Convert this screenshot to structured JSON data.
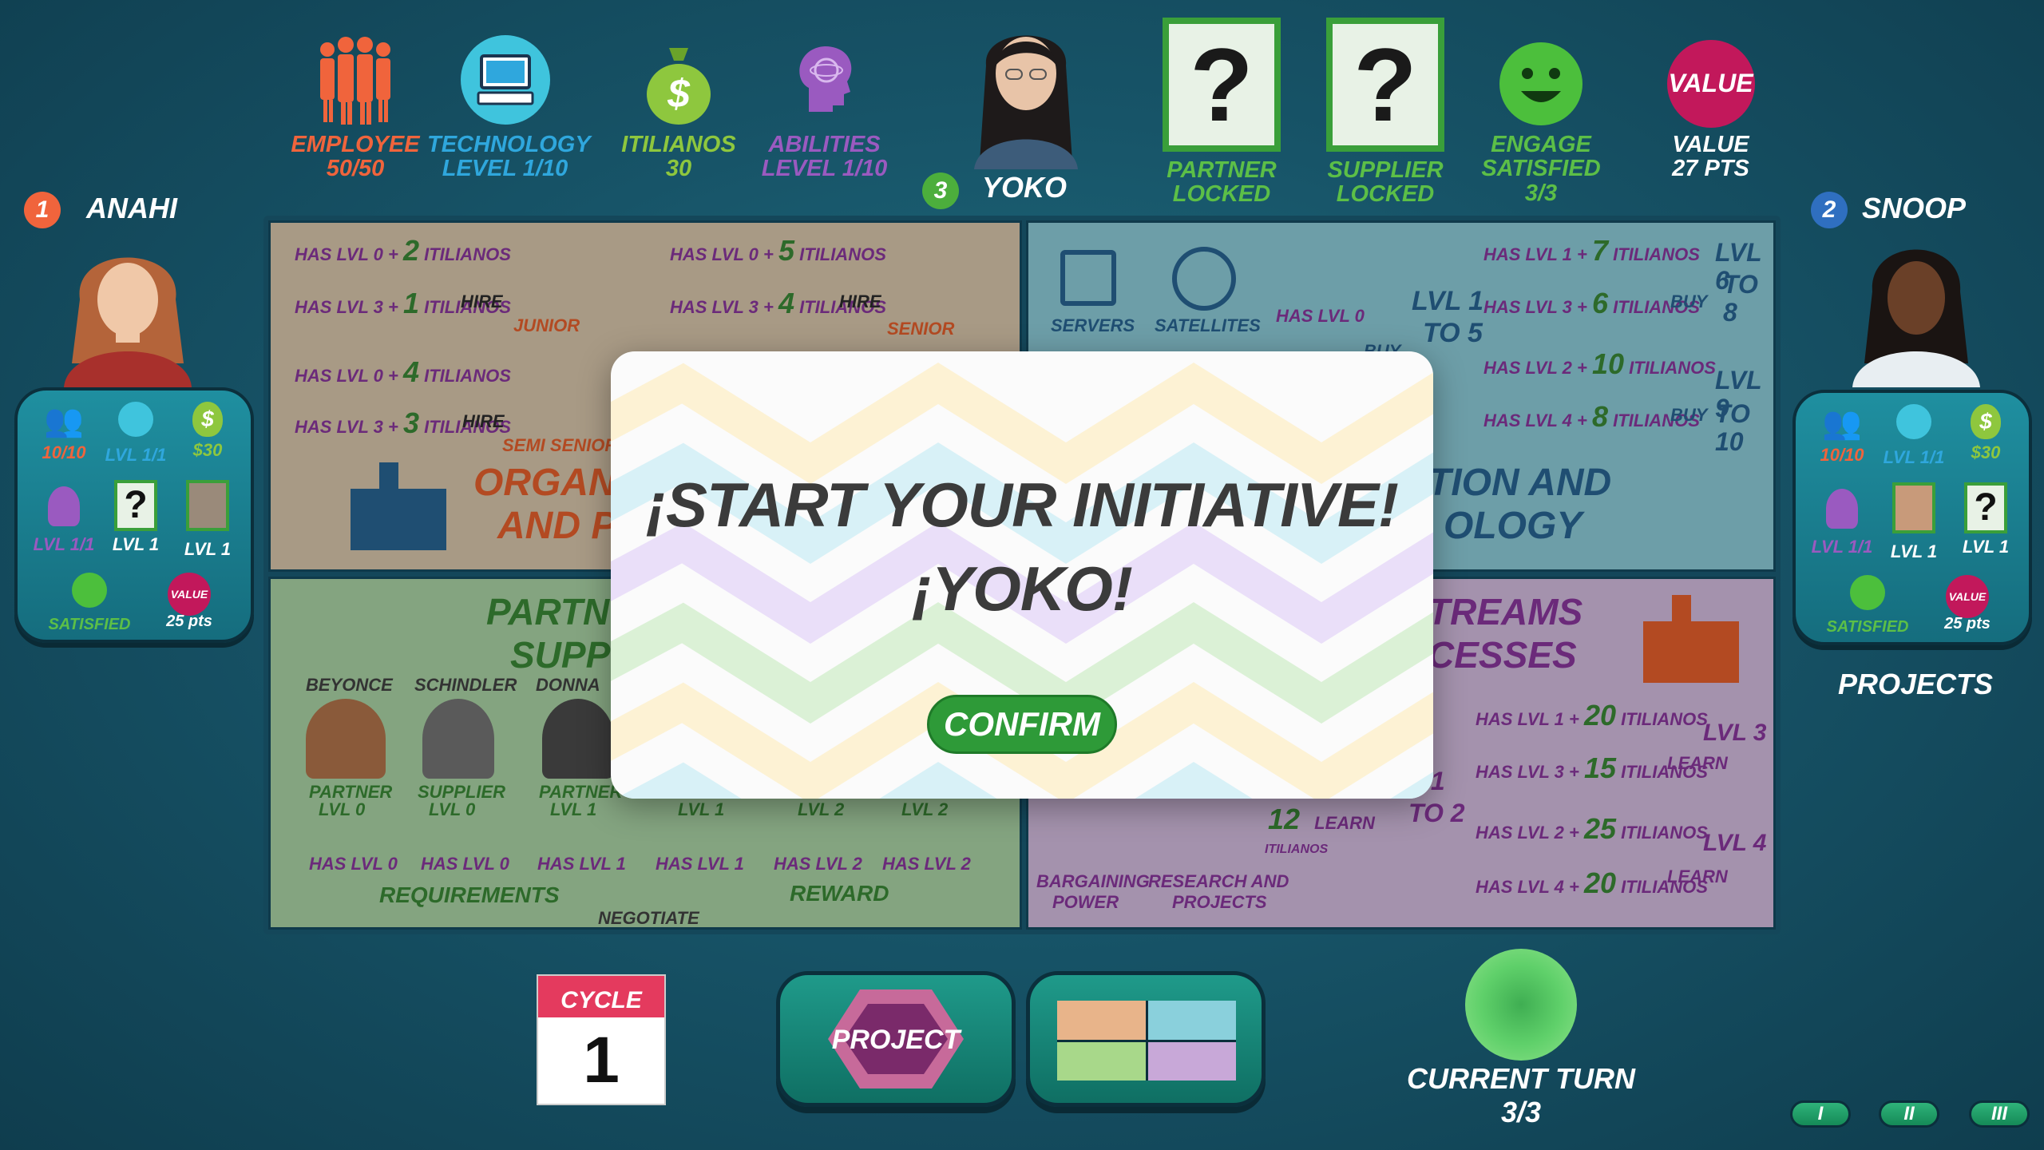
{
  "top_stats": {
    "employee": {
      "label": "EMPLOYEE",
      "value": "50/50",
      "icon": "employees-icon"
    },
    "technology": {
      "label": "TECHNOLOGY",
      "value": "LEVEL  1/10",
      "icon": "computer-icon"
    },
    "itilianos": {
      "label": "ITILIANOS",
      "value": "30",
      "icon": "money-bag-icon"
    },
    "abilities": {
      "label": "ABILITIES",
      "value": "LEVEL  1/10",
      "icon": "brain-head-icon"
    },
    "current_player": {
      "number": "3",
      "name": "YOKO"
    },
    "partner": {
      "label": "PARTNER",
      "status": "LOCKED"
    },
    "supplier": {
      "label": "SUPPLIER",
      "status": "LOCKED"
    },
    "engage": {
      "label1": "ENGAGE",
      "label2": "SATISFIED",
      "value": "3/3"
    },
    "value": {
      "badge": "VALUE",
      "label": "VALUE",
      "pts": "27 PTS"
    }
  },
  "players": {
    "left": {
      "number": "1",
      "name": "ANAHI",
      "employees": "10/10",
      "tech": "LVL 1/1",
      "money": "$30",
      "abilities": "LVL 1/1",
      "partner": "LVL 1",
      "supplier": "LVL 1",
      "engage": "SATISFIED",
      "value_badge": "VALUE",
      "value": "25 pts"
    },
    "right": {
      "number": "2",
      "name": "SNOOP",
      "employees": "10/10",
      "tech": "LVL 1/1",
      "money": "$30",
      "abilities": "LVL 1/1",
      "partner": "LVL 1",
      "supplier": "LVL 1",
      "engage": "SATISFIED",
      "value_badge": "VALUE",
      "value": "25 pts",
      "projects_label": "PROJECTS"
    }
  },
  "board": {
    "org": {
      "row1": {
        "req": "HAS LVL 0",
        "cost": "2",
        "cur": "ITILIANOS",
        "action": "HIRE",
        "role": "JUNIOR"
      },
      "row2": {
        "req": "HAS LVL 3",
        "cost": "1",
        "cur": "ITILIANOS"
      },
      "row3": {
        "req": "HAS LVL 0",
        "cost": "5",
        "cur": "ITILIANOS",
        "action": "HIRE",
        "role": "SENIOR"
      },
      "row4": {
        "req": "HAS LVL 3",
        "cost": "4",
        "cur": "ITILIANOS"
      },
      "row5": {
        "req": "HAS LVL 0",
        "cost": "4",
        "cur": "ITILIANOS",
        "action": "HIRE",
        "role": "SEMI SENIOR"
      },
      "row6": {
        "req": "HAS LVL 3",
        "cost": "3",
        "cur": "ITILIANOS"
      },
      "title1": "ORGANI",
      "title2": "AND P"
    },
    "tech": {
      "servers": "SERVERS",
      "satellites": "SATELLITES",
      "lvl0": "HAS LVL 0",
      "buy": "BUY",
      "lvl_range1": "LVL 1",
      "lvl_range1b": "TO 5",
      "r1": {
        "req": "HAS LVL 1",
        "cost": "7",
        "cur": "ITILIANOS"
      },
      "r2": {
        "req": "HAS LVL 3",
        "cost": "6",
        "cur": "ITILIANOS"
      },
      "r3": {
        "req": "HAS LVL 2",
        "cost": "10",
        "cur": "ITILIANOS"
      },
      "r4": {
        "req": "HAS LVL 4",
        "cost": "8",
        "cur": "ITILIANOS"
      },
      "buy1": "BUY",
      "buy2": "BUY",
      "lvl6": "LVL 6",
      "to8": "TO 8",
      "lvl9": "LVL 9",
      "to10": "TO 10",
      "title1": "TION AND",
      "title2": "OLOGY"
    },
    "partners": {
      "title1": "PARTN",
      "title2": "SUPP",
      "beyonce": "BEYONCE",
      "schindler": "SCHINDLER",
      "donna": "DONNA",
      "p1_role": "PARTNER",
      "p1_lvl": "LVL 0",
      "p2_role": "SUPPLIER",
      "p2_lvl": "LVL 0",
      "p3_role": "PARTNER",
      "p3_lvl": "LVL 1",
      "lvl1": "LVL 1",
      "lvl2a": "LVL 2",
      "lvl2b": "LVL 2",
      "has0a": "HAS LVL 0",
      "has0b": "HAS LVL 0",
      "has1a": "HAS LVL 1",
      "has1b": "HAS LVL 1",
      "has2a": "HAS LVL 2",
      "has2b": "HAS LVL 2",
      "requirements": "REQUIREMENTS",
      "negotiate": "NEGOTIATE",
      "reward": "REWARD"
    },
    "processes": {
      "title1": "TREAMS",
      "title2": "CESSES",
      "r1": {
        "req": "HAS LVL 1",
        "cost": "20",
        "cur": "ITILIANOS",
        "target": "LVL 3",
        "action": "LEARN"
      },
      "r2": {
        "req": "HAS LVL 3",
        "cost": "15",
        "cur": "ITILIANOS"
      },
      "r3": {
        "req": "HAS LVL 2",
        "cost": "25",
        "cur": "ITILIANOS",
        "target": "LVL 4",
        "action": "LEARN"
      },
      "r4": {
        "req": "HAS LVL 4",
        "cost": "20",
        "cur": "ITILIANOS"
      },
      "mid_cost": "12",
      "mid_cur": "ITILIANOS",
      "mid_action": "LEARN",
      "mid_lvl": "L 1",
      "mid_to": "TO 2",
      "bargaining1": "BARGAINING",
      "bargaining2": "POWER",
      "research1": "RESEARCH AND",
      "research2": "PROJECTS"
    }
  },
  "modal": {
    "line1": "¡START YOUR INITIATIVE!",
    "line2": "¡YOKO!",
    "confirm": "CONFIRM"
  },
  "bottom": {
    "cycle_label": "CYCLE",
    "cycle_number": "1",
    "project_label": "PROJECT",
    "current_turn_label": "CURRENT TURN",
    "current_turn_value": "3/3",
    "speed_buttons": [
      "I",
      "II",
      "III"
    ]
  },
  "colors": {
    "background": "#175468",
    "orange": "#f0643c",
    "blue": "#2fa7dd",
    "green": "#8ec73e",
    "purple": "#9a5ac0",
    "value_badge": "#c2185b",
    "confirm": "#2e9a38"
  }
}
